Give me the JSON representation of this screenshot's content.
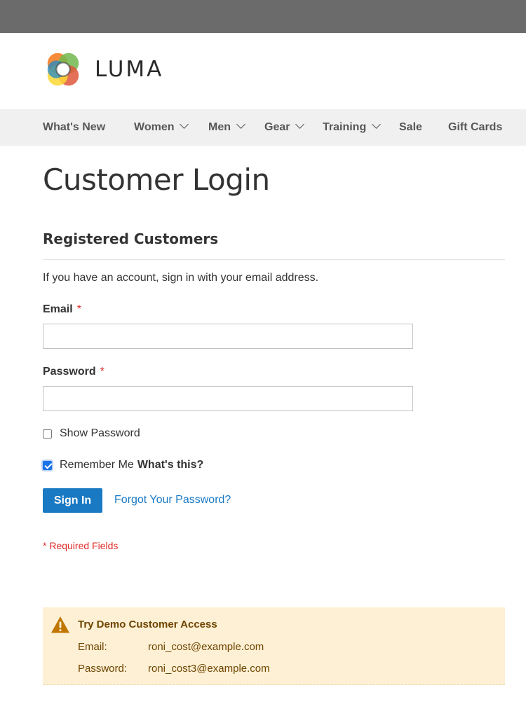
{
  "brand": {
    "name": "LUMA"
  },
  "nav": {
    "items": [
      {
        "label": "What's New",
        "has_dropdown": false
      },
      {
        "label": "Women",
        "has_dropdown": true
      },
      {
        "label": "Men",
        "has_dropdown": true
      },
      {
        "label": "Gear",
        "has_dropdown": true
      },
      {
        "label": "Training",
        "has_dropdown": true
      },
      {
        "label": "Sale",
        "has_dropdown": false
      },
      {
        "label": "Gift Cards",
        "has_dropdown": false
      }
    ]
  },
  "page": {
    "title": "Customer Login"
  },
  "login": {
    "section_title": "Registered Customers",
    "intro": "If you have an account, sign in with your email address.",
    "email_label": "Email",
    "email_value": "",
    "password_label": "Password",
    "password_value": "",
    "required_marker": "*",
    "show_password_label": "Show Password",
    "show_password_checked": false,
    "remember_me_label": "Remember Me",
    "remember_me_checked": true,
    "whats_this": "What's this?",
    "sign_in_label": "Sign In",
    "forgot_label": "Forgot Your Password?",
    "required_note": "* Required Fields"
  },
  "demo": {
    "title": "Try Demo Customer Access",
    "email_key": "Email:",
    "email_value": "roni_cost@example.com",
    "password_key": "Password:",
    "password_value": "roni_cost3@example.com",
    "icon": "warning-icon"
  },
  "colors": {
    "accent": "#1979c3",
    "required": "#e02b27",
    "notice_bg": "#fdf0d5",
    "notice_text": "#6f4400"
  }
}
